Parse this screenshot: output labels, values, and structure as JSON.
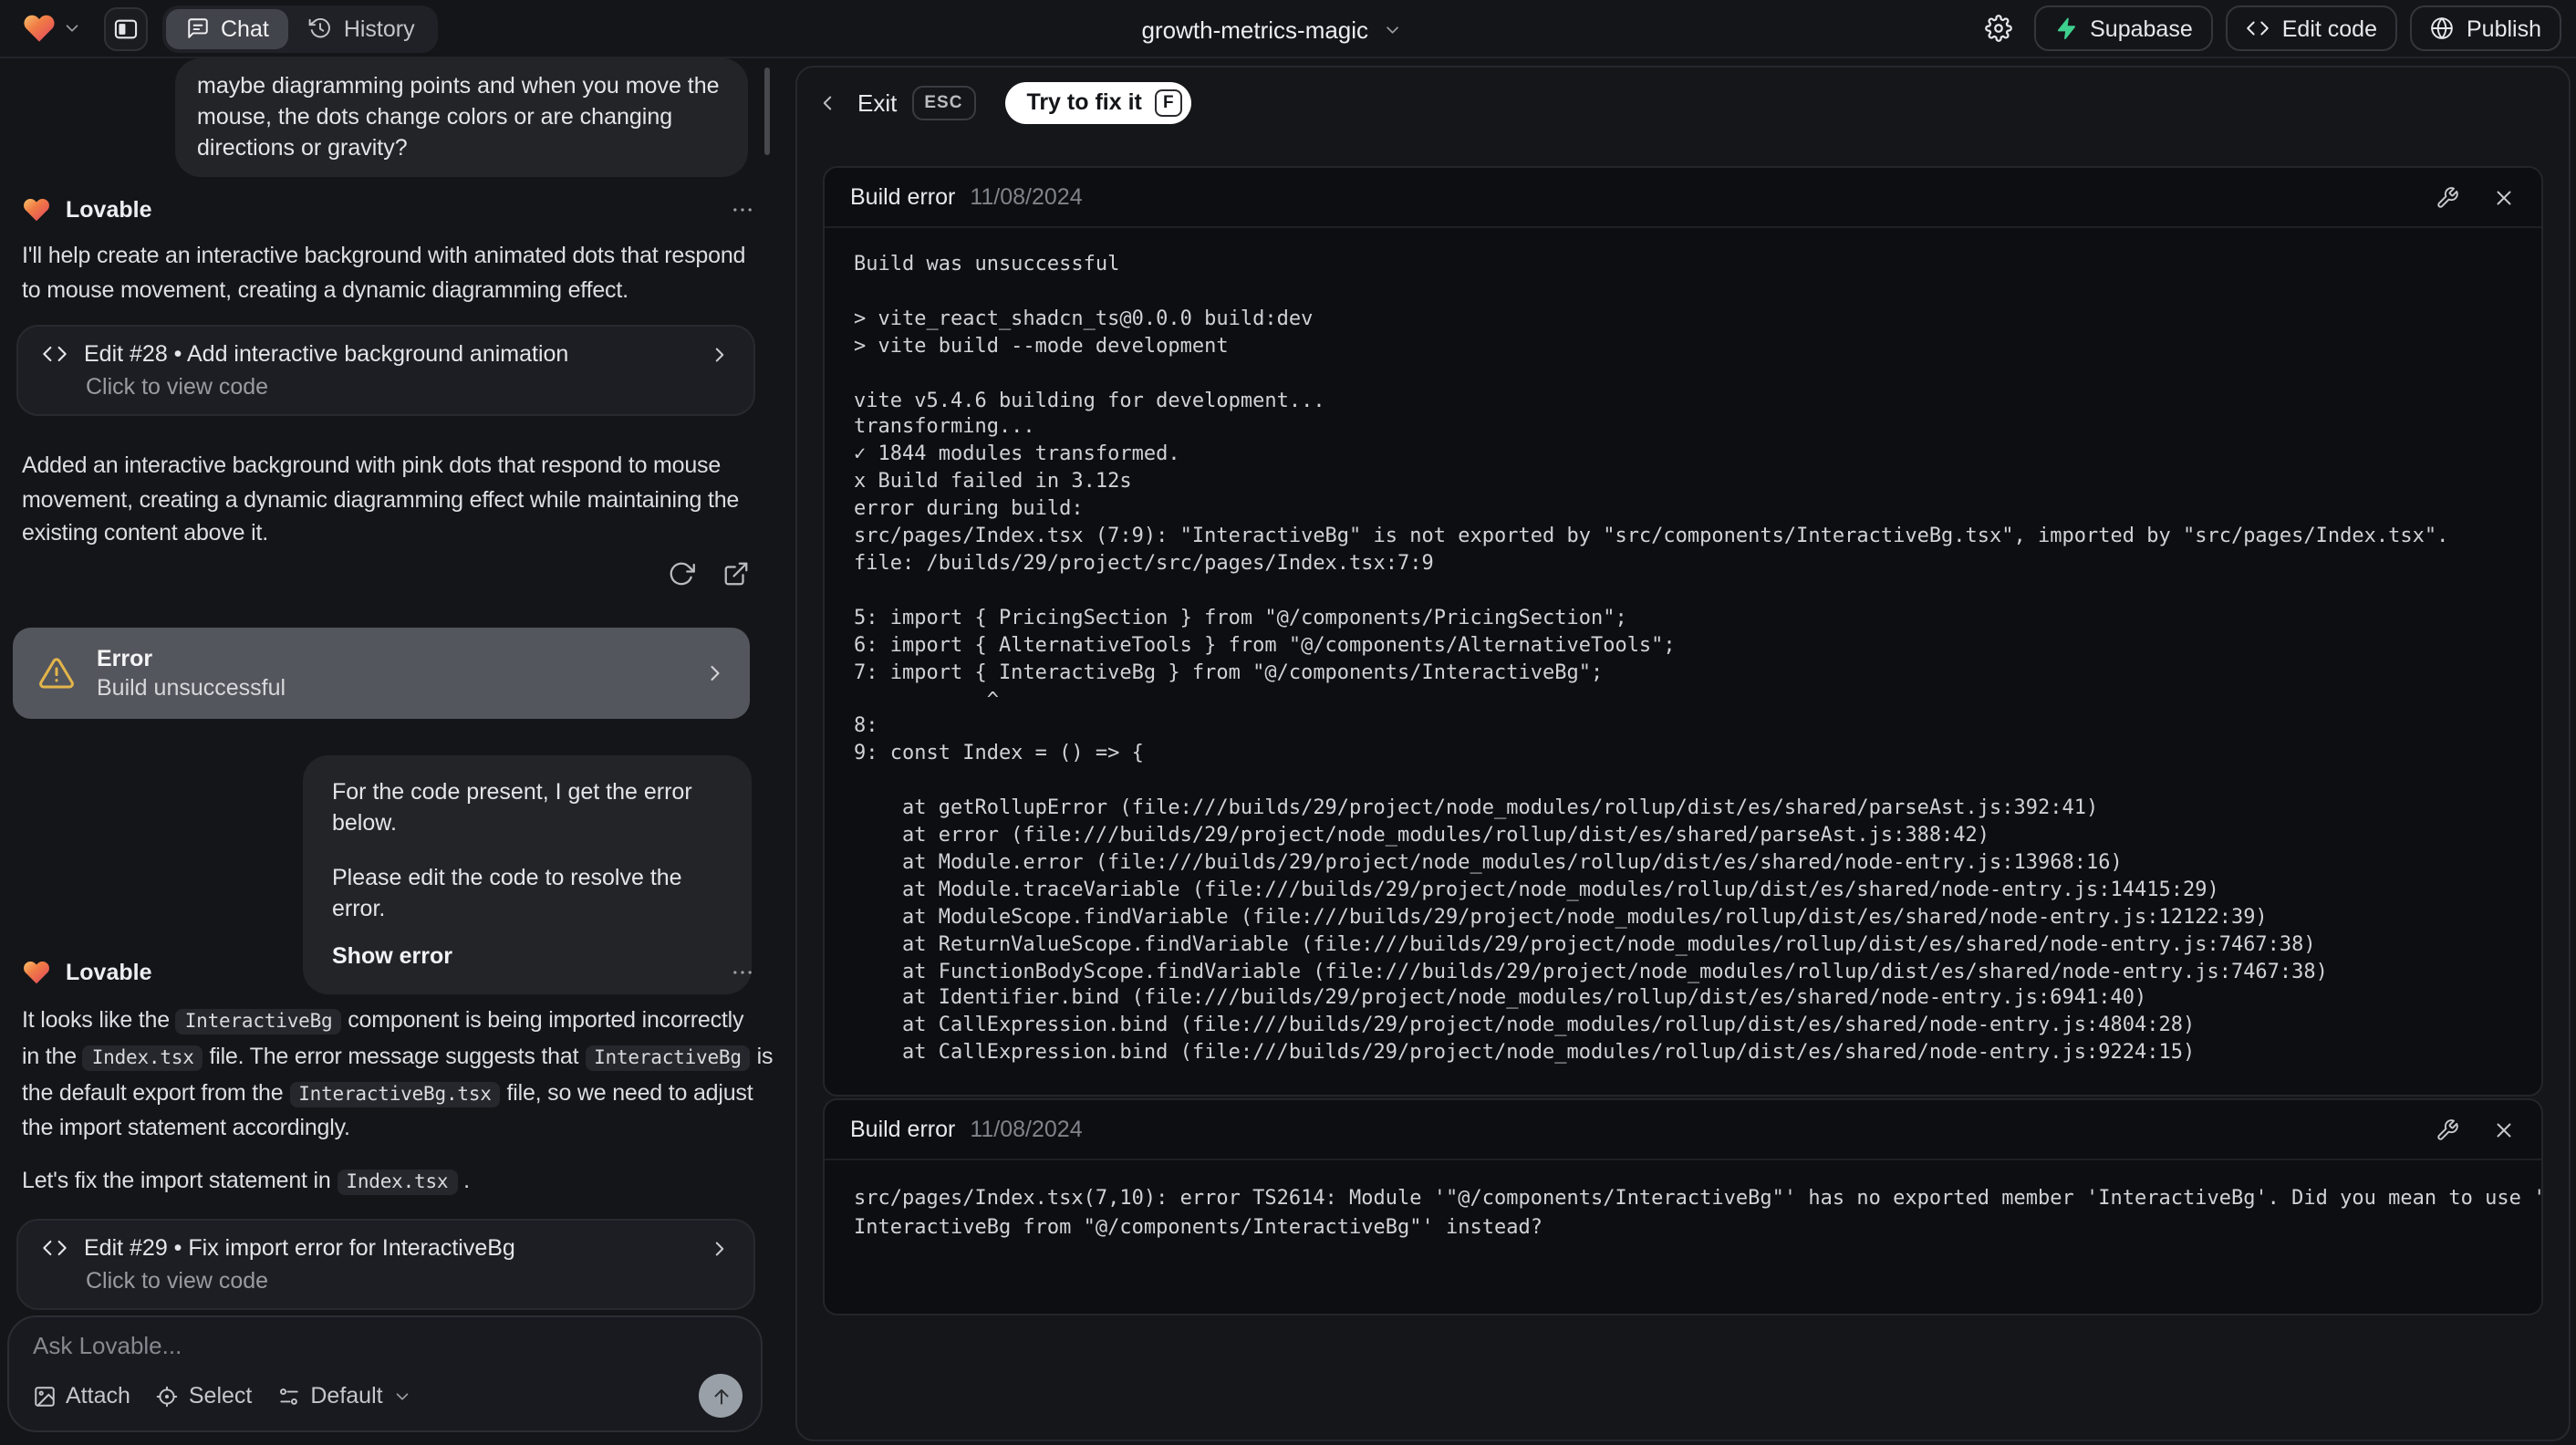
{
  "topbar": {
    "tab_chat": "Chat",
    "tab_history": "History",
    "project_title": "growth-metrics-magic",
    "supabase": "Supabase",
    "edit_code": "Edit code",
    "publish": "Publish"
  },
  "chat": {
    "assistant_name": "Lovable",
    "user_message_1": "maybe diagramming points and when you move the\nmouse, the dots change colors or are changing\ndirections or gravity?",
    "response_1": "I'll help create an interactive background with animated dots that respond\nto mouse movement, creating a dynamic diagramming effect.",
    "edit_28_title": "Edit #28 • Add interactive background animation",
    "edit_28_subtitle": "Click to view code",
    "response_1b": "Added an interactive background with pink dots that respond to mouse\nmovement, creating a dynamic diagramming effect while maintaining the\nexisting content above it.",
    "error_card_title": "Error",
    "error_card_subtitle": "Build unsuccessful",
    "user_message_2a": "For the code present, I get the error below.",
    "user_message_2b": "Please edit the code to resolve the error.",
    "user_message_2_link": "Show error",
    "response_2_segments": [
      {
        "t": "It looks like the "
      },
      {
        "c": "InteractiveBg"
      },
      {
        "t": " component is being imported incorrectly\nin the "
      },
      {
        "c": "Index.tsx"
      },
      {
        "t": " file. The error message suggests that "
      },
      {
        "c": "InteractiveBg"
      },
      {
        "t": " is\nthe default export from the "
      },
      {
        "c": "InteractiveBg.tsx"
      },
      {
        "t": " file, so we need to adjust\nthe import statement accordingly."
      }
    ],
    "response_2b_segments": [
      {
        "t": "Let's fix the import statement in "
      },
      {
        "c": "Index.tsx"
      },
      {
        "t": " ."
      }
    ],
    "edit_29_title": "Edit #29 • Fix import error for InteractiveBg",
    "edit_29_subtitle": "Click to view code",
    "input_placeholder": "Ask Lovable...",
    "attach": "Attach",
    "select": "Select",
    "mode": "Default"
  },
  "error_view": {
    "exit": "Exit",
    "esc": "ESC",
    "fix": "Try to fix it",
    "fix_key": "F",
    "card1": {
      "title": "Build error",
      "date": "11/08/2024",
      "log": "Build was unsuccessful\n\n> vite_react_shadcn_ts@0.0.0 build:dev\n> vite build --mode development\n\nvite v5.4.6 building for development...\ntransforming...\n✓ 1844 modules transformed.\nx Build failed in 3.12s\nerror during build:\nsrc/pages/Index.tsx (7:9): \"InteractiveBg\" is not exported by \"src/components/InteractiveBg.tsx\", imported by \"src/pages/Index.tsx\".\nfile: /builds/29/project/src/pages/Index.tsx:7:9\n\n5: import { PricingSection } from \"@/components/PricingSection\";\n6: import { AlternativeTools } from \"@/components/AlternativeTools\";\n7: import { InteractiveBg } from \"@/components/InteractiveBg\";\n           ^\n8: \n9: const Index = () => {\n\n    at getRollupError (file:///builds/29/project/node_modules/rollup/dist/es/shared/parseAst.js:392:41)\n    at error (file:///builds/29/project/node_modules/rollup/dist/es/shared/parseAst.js:388:42)\n    at Module.error (file:///builds/29/project/node_modules/rollup/dist/es/shared/node-entry.js:13968:16)\n    at Module.traceVariable (file:///builds/29/project/node_modules/rollup/dist/es/shared/node-entry.js:14415:29)\n    at ModuleScope.findVariable (file:///builds/29/project/node_modules/rollup/dist/es/shared/node-entry.js:12122:39)\n    at ReturnValueScope.findVariable (file:///builds/29/project/node_modules/rollup/dist/es/shared/node-entry.js:7467:38)\n    at FunctionBodyScope.findVariable (file:///builds/29/project/node_modules/rollup/dist/es/shared/node-entry.js:7467:38)\n    at Identifier.bind (file:///builds/29/project/node_modules/rollup/dist/es/shared/node-entry.js:6941:40)\n    at CallExpression.bind (file:///builds/29/project/node_modules/rollup/dist/es/shared/node-entry.js:4804:28)\n    at CallExpression.bind (file:///builds/29/project/node_modules/rollup/dist/es/shared/node-entry.js:9224:15)"
    },
    "card2": {
      "title": "Build error",
      "date": "11/08/2024",
      "log": "src/pages/Index.tsx(7,10): error TS2614: Module '\"@/components/InteractiveBg\"' has no exported member 'InteractiveBg'. Did you mean to use 'import\nInteractiveBg from \"@/components/InteractiveBg\"' instead?"
    }
  },
  "colors": {
    "supabase_green": "#3ecf8e",
    "warning_yellow": "#e3b54a",
    "fix_pill_bg": "#ffffff",
    "error_card_bg": "#54565d"
  }
}
